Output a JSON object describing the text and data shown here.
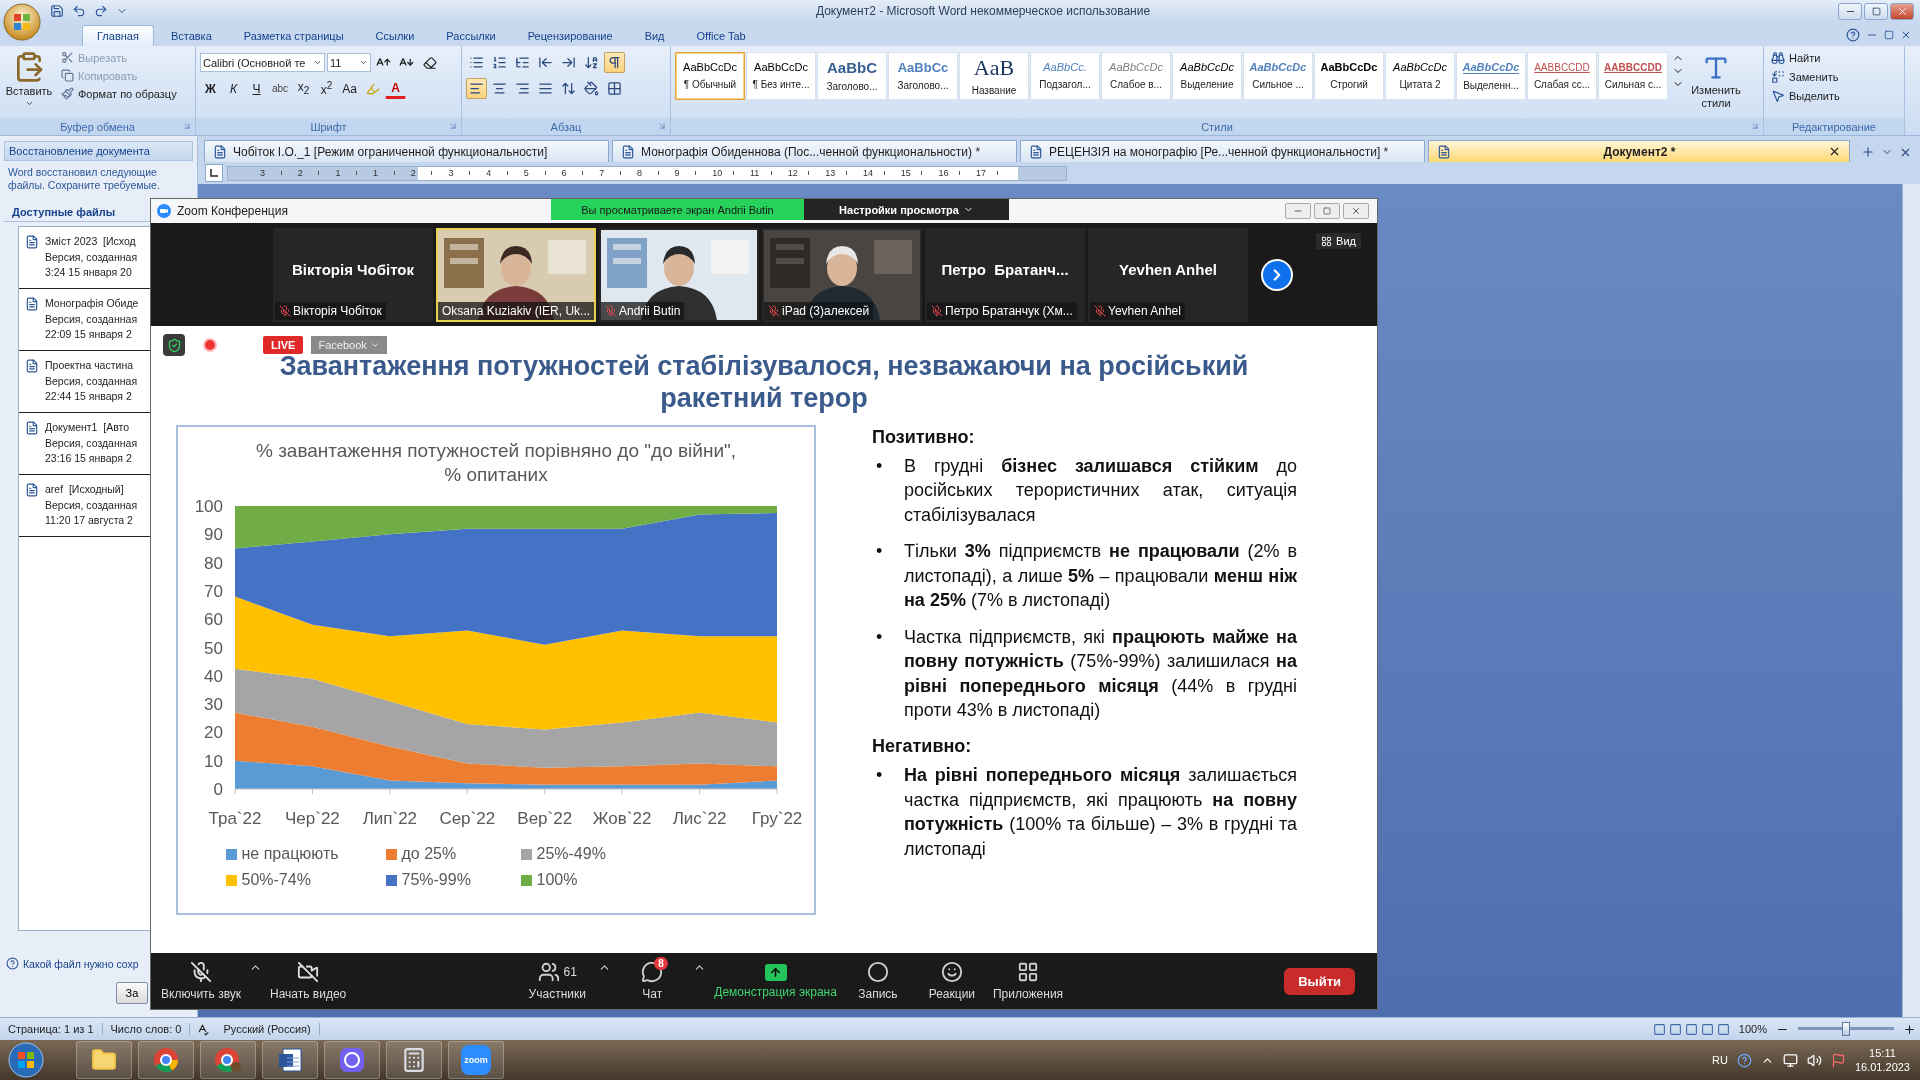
{
  "word": {
    "title": "Документ2 - Microsoft Word некоммерческое использование",
    "ribbon_tabs": [
      {
        "label": "Главная",
        "selected": true
      },
      {
        "label": "Вставка",
        "selected": false
      },
      {
        "label": "Разметка страницы",
        "selected": false
      },
      {
        "label": "Ссылки",
        "selected": false
      },
      {
        "label": "Рассылки",
        "selected": false
      },
      {
        "label": "Рецензирование",
        "selected": false
      },
      {
        "label": "Вид",
        "selected": false
      },
      {
        "label": "Office Tab",
        "selected": false
      }
    ],
    "clipboard": {
      "label": "Буфер обмена",
      "paste": "Вставить",
      "items": [
        {
          "kind": "cut",
          "label": "Вырезать",
          "disabled": true
        },
        {
          "kind": "copy",
          "label": "Копировать",
          "disabled": true
        },
        {
          "kind": "painter",
          "label": "Формат по образцу",
          "disabled": false
        }
      ]
    },
    "font": {
      "label": "Шрифт",
      "family": "Calibri (Основной те",
      "size": "11",
      "format_buttons": [
        {
          "kind": "bold",
          "label": "Ж"
        },
        {
          "kind": "italic",
          "label": "К"
        },
        {
          "kind": "underline",
          "label": "Ч"
        },
        {
          "kind": "strike",
          "label": "abc"
        },
        {
          "kind": "sub",
          "label": "x$_{2}$"
        },
        {
          "kind": "sup",
          "label": "x$^{2}$"
        },
        {
          "kind": "case",
          "label": "Aa"
        }
      ],
      "color_button": "A"
    },
    "paragraph": {
      "label": "Абзац",
      "rows": [
        [
          {
            "kind": "bullets",
            "active": false
          },
          {
            "kind": "numbering",
            "active": false
          },
          {
            "kind": "multilevel",
            "active": false
          },
          {
            "kind": "outdent",
            "active": false
          },
          {
            "kind": "indent",
            "active": false
          },
          {
            "kind": "sort",
            "active": false
          },
          {
            "kind": "pilcrow",
            "active": true
          }
        ],
        [
          {
            "kind": "left",
            "active": true
          },
          {
            "kind": "center",
            "active": false
          },
          {
            "kind": "right",
            "active": false
          },
          {
            "kind": "justify",
            "active": false
          },
          {
            "kind": "spacing",
            "active": false
          },
          {
            "kind": "shading",
            "active": false
          },
          {
            "kind": "borders",
            "active": false
          }
        ]
      ]
    },
    "styles": {
      "label": "Стили",
      "change": "Изменить стили",
      "items": [
        {
          "preview": "AaBbCcDc",
          "name": "¶ Обычный",
          "kind": "normal",
          "selected": true
        },
        {
          "preview": "AaBbCcDc",
          "name": "¶ Без инте...",
          "kind": "normal",
          "selected": false
        },
        {
          "preview": "AaBbC",
          "name": "Заголово...",
          "kind": "heading1",
          "selected": false
        },
        {
          "preview": "AaBbCc",
          "name": "Заголово...",
          "kind": "heading2",
          "selected": false
        },
        {
          "preview": "AaB",
          "name": "Название",
          "kind": "title",
          "selected": false
        },
        {
          "preview": "AaBbCc.",
          "name": "Подзагол...",
          "kind": "subtitle",
          "selected": false
        },
        {
          "preview": "AaBbCcDc",
          "name": "Слабое в...",
          "kind": "subtle",
          "selected": false
        },
        {
          "preview": "AaBbCcDc",
          "name": "Выделение",
          "kind": "emphasis",
          "selected": false
        },
        {
          "preview": "AaBbCcDc",
          "name": "Сильное ...",
          "kind": "intense",
          "selected": false
        },
        {
          "preview": "AaBbCcDc",
          "name": "Строгий",
          "kind": "strong",
          "selected": false
        },
        {
          "preview": "AaBbCcDc",
          "name": "Цитата 2",
          "kind": "quote",
          "selected": false
        },
        {
          "preview": "AaBbCcDc",
          "name": "Выделенн...",
          "kind": "intensequote",
          "selected": false
        },
        {
          "preview": "AABBCCDD",
          "name": "Слабая сс...",
          "kind": "subtleref",
          "selected": false
        },
        {
          "preview": "AABBCCDD",
          "name": "Сильная с...",
          "kind": "intenseref",
          "selected": false
        }
      ]
    },
    "editing": {
      "label": "Редактирование",
      "items": [
        {
          "kind": "find",
          "label": "Найти"
        },
        {
          "kind": "replace",
          "label": "Заменить"
        },
        {
          "kind": "select",
          "label": "Выделить"
        }
      ]
    }
  },
  "recovery": {
    "title": "Восстановление документа",
    "message": "Word восстановил следующие файлы.  Сохраните требуемые.",
    "files_heading": "Доступные файлы",
    "files": [
      {
        "name": "Зміст 2023  [Исход",
        "version": "Версия, созданная",
        "time": "3:24 15 января 20"
      },
      {
        "name": "Монографія Обиде",
        "version": "Версия, созданная",
        "time": "22:09 15 января 2"
      },
      {
        "name": "Проектна частина",
        "version": "Версия, созданная",
        "time": "22:44 15 января 2"
      },
      {
        "name": "Документ1  [Авто",
        "version": "Версия, созданная",
        "time": "23:16 15 января 2"
      },
      {
        "name": "aref  [Исходный]",
        "version": "Версия, созданная",
        "time": "11:20 17 августа 2"
      }
    ],
    "help": "Какой файл нужно сохр",
    "button": "За"
  },
  "document_tabs": [
    {
      "label": "Чобіток І.О._1 [Режим ограниченной функциональности]",
      "selected": false
    },
    {
      "label": "Монографія Обиденнова (Пос...ченной функциональности) *",
      "selected": false
    },
    {
      "label": "РЕЦЕНЗІЯ  на монографію [Ре...ченной функциональности] *",
      "selected": false
    },
    {
      "label": "Документ2 *",
      "selected": true
    }
  ],
  "ruler": [
    "3",
    "2",
    "1",
    "1",
    "2",
    "3",
    "4",
    "5",
    "6",
    "7",
    "8",
    "9",
    "10",
    "11",
    "12",
    "13",
    "14",
    "15",
    "16",
    "17"
  ],
  "zoom": {
    "title": "Zoom Конференция",
    "viewing_banner": "Вы просматриваете экран Andrii Butin",
    "view_settings": "Настройки просмотра",
    "view_button": "Вид",
    "participants": [
      {
        "kind": "name",
        "display": "Вікторія Чобіток",
        "label": "Вікторія Чобіток",
        "muted": true,
        "speaking": false
      },
      {
        "kind": "video",
        "label": "Oksana Kuziakiv (IER, Uk...",
        "muted": false,
        "speaking": true
      },
      {
        "kind": "video",
        "label": "Andrii Butin",
        "muted": true,
        "speaking": false
      },
      {
        "kind": "video",
        "label": "iPad (3)алексей",
        "muted": true,
        "speaking": false
      },
      {
        "kind": "name",
        "display": "Петро  Братанч...",
        "label": "Петро Братанчук (Хм...",
        "muted": true,
        "speaking": false
      },
      {
        "kind": "name",
        "display": "Yevhen Anhel",
        "label": "Yevhen Anhel",
        "muted": true,
        "speaking": false
      }
    ],
    "live": "LIVE",
    "stream": "Facebook",
    "slide": {
      "title": "Завантаження потужностей стабілізувалося, незважаючи на російський ракетний терор",
      "chart_data": {
        "type": "area",
        "stacked": true,
        "legend": "bottom",
        "title": "% завантаження потужностей порівняно до \"до війни\", % опитаних",
        "categories": [
          "Тра`22",
          "Чер`22",
          "Лип`22",
          "Сер`22",
          "Вер`22",
          "Жов`22",
          "Лис`22",
          "Гру`22"
        ],
        "ylim": [
          0,
          100
        ],
        "yticks": [
          0,
          10,
          20,
          30,
          40,
          50,
          60,
          70,
          80,
          90,
          100
        ],
        "series": [
          {
            "name": "не працюють",
            "color": "#5b9bd5",
            "values": [
              10,
              8,
              3,
              2,
              1.5,
              1.5,
              1.5,
              3
            ]
          },
          {
            "name": "до 25%",
            "color": "#ed7d31",
            "values": [
              17,
              14,
              12,
              7,
              6,
              6.5,
              7.5,
              5
            ]
          },
          {
            "name": "25%-49%",
            "color": "#a5a5a5",
            "values": [
              15.5,
              17,
              16,
              14,
              13.5,
              15.5,
              18,
              15.5
            ]
          },
          {
            "name": "50%-74%",
            "color": "#ffc000",
            "values": [
              25.5,
              19,
              23,
              33,
              30,
              32.5,
              27,
              30.5
            ]
          },
          {
            "name": "75%-99%",
            "color": "#4472c4",
            "values": [
              17,
              29.5,
              36,
              36,
              41,
              36,
              43,
              43.5
            ]
          },
          {
            "name": "100%",
            "color": "#70ad47",
            "values": [
              15,
              12.5,
              10,
              8,
              8,
              8,
              3,
              2.5
            ]
          }
        ]
      },
      "sections": [
        {
          "heading": "Позитивно:",
          "bullets": [
            {
              "marker": "•",
              "text": "В грудні **бізнес залишався стійким** до російських терористичних атак, ситуація стабілізувалася"
            },
            {
              "marker": "•",
              "text": "Тільки **3%** підприємств **не працювали** (2% в листопаді), а лише **5%** – працювали **менш ніж на 25%** (7% в листопаді)"
            },
            {
              "marker": "•",
              "text": "Частка підприємств, які **працюють майже на повну потужність** (75%-99%) залишилася **на рівні попереднього місяця** (44% в грудні проти 43% в листопаді)"
            }
          ]
        },
        {
          "heading": "Негативно:",
          "bullets": [
            {
              "marker": "•",
              "text": "**На рівні попереднього місяця** залишається частка підприємств, які працюють **на повну потужність** (100% та більше)  – 3% в грудні та листопаді"
            }
          ]
        }
      ]
    },
    "left_controls": [
      {
        "kind": "audio",
        "label": "Включить звук",
        "caret": true
      },
      {
        "kind": "video",
        "label": "Начать видео",
        "caret": false
      }
    ],
    "center_controls": [
      {
        "kind": "participants",
        "label": "Участники",
        "count": "61",
        "caret": true
      },
      {
        "kind": "chat",
        "label": "Чат",
        "badge": "8",
        "caret": true
      },
      {
        "kind": "share",
        "label": "Демонстрация экрана",
        "caret": false
      },
      {
        "kind": "record",
        "label": "Запись",
        "caret": false
      },
      {
        "kind": "reactions",
        "label": "Реакции",
        "caret": false
      },
      {
        "kind": "apps",
        "label": "Приложения",
        "caret": false
      }
    ],
    "leave": "Выйти"
  },
  "status_bar": {
    "page": "Страница: 1 из 1",
    "words": "Число слов: 0",
    "language": "Русский (Россия)",
    "zoom_percent": "100%",
    "zoom_slider": {
      "level": 0.5
    }
  },
  "taskbar": {
    "apps": [
      {
        "kind": "explorer"
      },
      {
        "kind": "chrome"
      },
      {
        "kind": "chrome-profile"
      },
      {
        "kind": "word"
      },
      {
        "kind": "viber"
      },
      {
        "kind": "calculator"
      },
      {
        "kind": "zoom",
        "label": "zoom"
      }
    ],
    "language": "RU",
    "time": "15:11",
    "date": "16.01.2023"
  }
}
